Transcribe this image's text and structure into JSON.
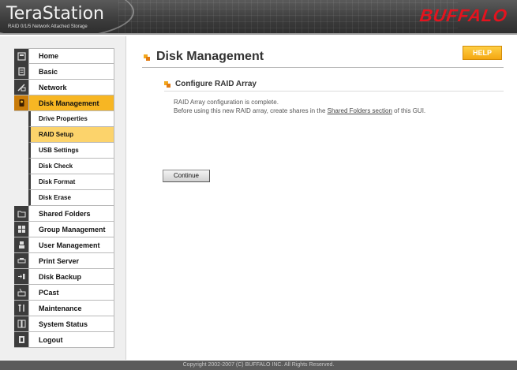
{
  "header": {
    "product_name": "TeraStation",
    "product_tagline": "RAID 0/1/5 Network Attached Storage",
    "brand": "BUFFALO"
  },
  "sidebar": {
    "items": [
      {
        "label": "Home",
        "icon": "home-icon"
      },
      {
        "label": "Basic",
        "icon": "document-icon"
      },
      {
        "label": "Network",
        "icon": "network-icon"
      },
      {
        "label": "Disk Management",
        "icon": "disk-icon",
        "active": true
      },
      {
        "label": "Shared Folders",
        "icon": "folder-icon"
      },
      {
        "label": "Group Management",
        "icon": "group-icon"
      },
      {
        "label": "User Management",
        "icon": "user-icon"
      },
      {
        "label": "Print Server",
        "icon": "printer-icon"
      },
      {
        "label": "Disk Backup",
        "icon": "backup-icon"
      },
      {
        "label": "PCast",
        "icon": "pcast-icon"
      },
      {
        "label": "Maintenance",
        "icon": "tools-icon"
      },
      {
        "label": "System Status",
        "icon": "status-icon"
      },
      {
        "label": "Logout",
        "icon": "logout-icon"
      }
    ],
    "sub_items": [
      {
        "label": "Drive Properties"
      },
      {
        "label": "RAID Setup",
        "active": true
      },
      {
        "label": "USB Settings"
      },
      {
        "label": "Disk Check"
      },
      {
        "label": "Disk Format"
      },
      {
        "label": "Disk Erase"
      }
    ]
  },
  "main": {
    "page_title": "Disk Management",
    "help_label": "HELP",
    "section_title": "Configure RAID Array",
    "message_line1": "RAID Array configuration is complete.",
    "message_line2_before": "Before using this new RAID array, create shares in the",
    "message_link": "Shared Folders section",
    "message_line2_after": "of this GUI.",
    "continue_label": "Continue"
  },
  "footer": {
    "copyright": "Copyright 2002-2007 (C) BUFFALO INC. All Rights Reserved."
  },
  "colors": {
    "accent": "#f7b623",
    "active_sub": "#fcd36b",
    "brand_red": "#e4131e",
    "header_bg": "#3c3c3c"
  }
}
